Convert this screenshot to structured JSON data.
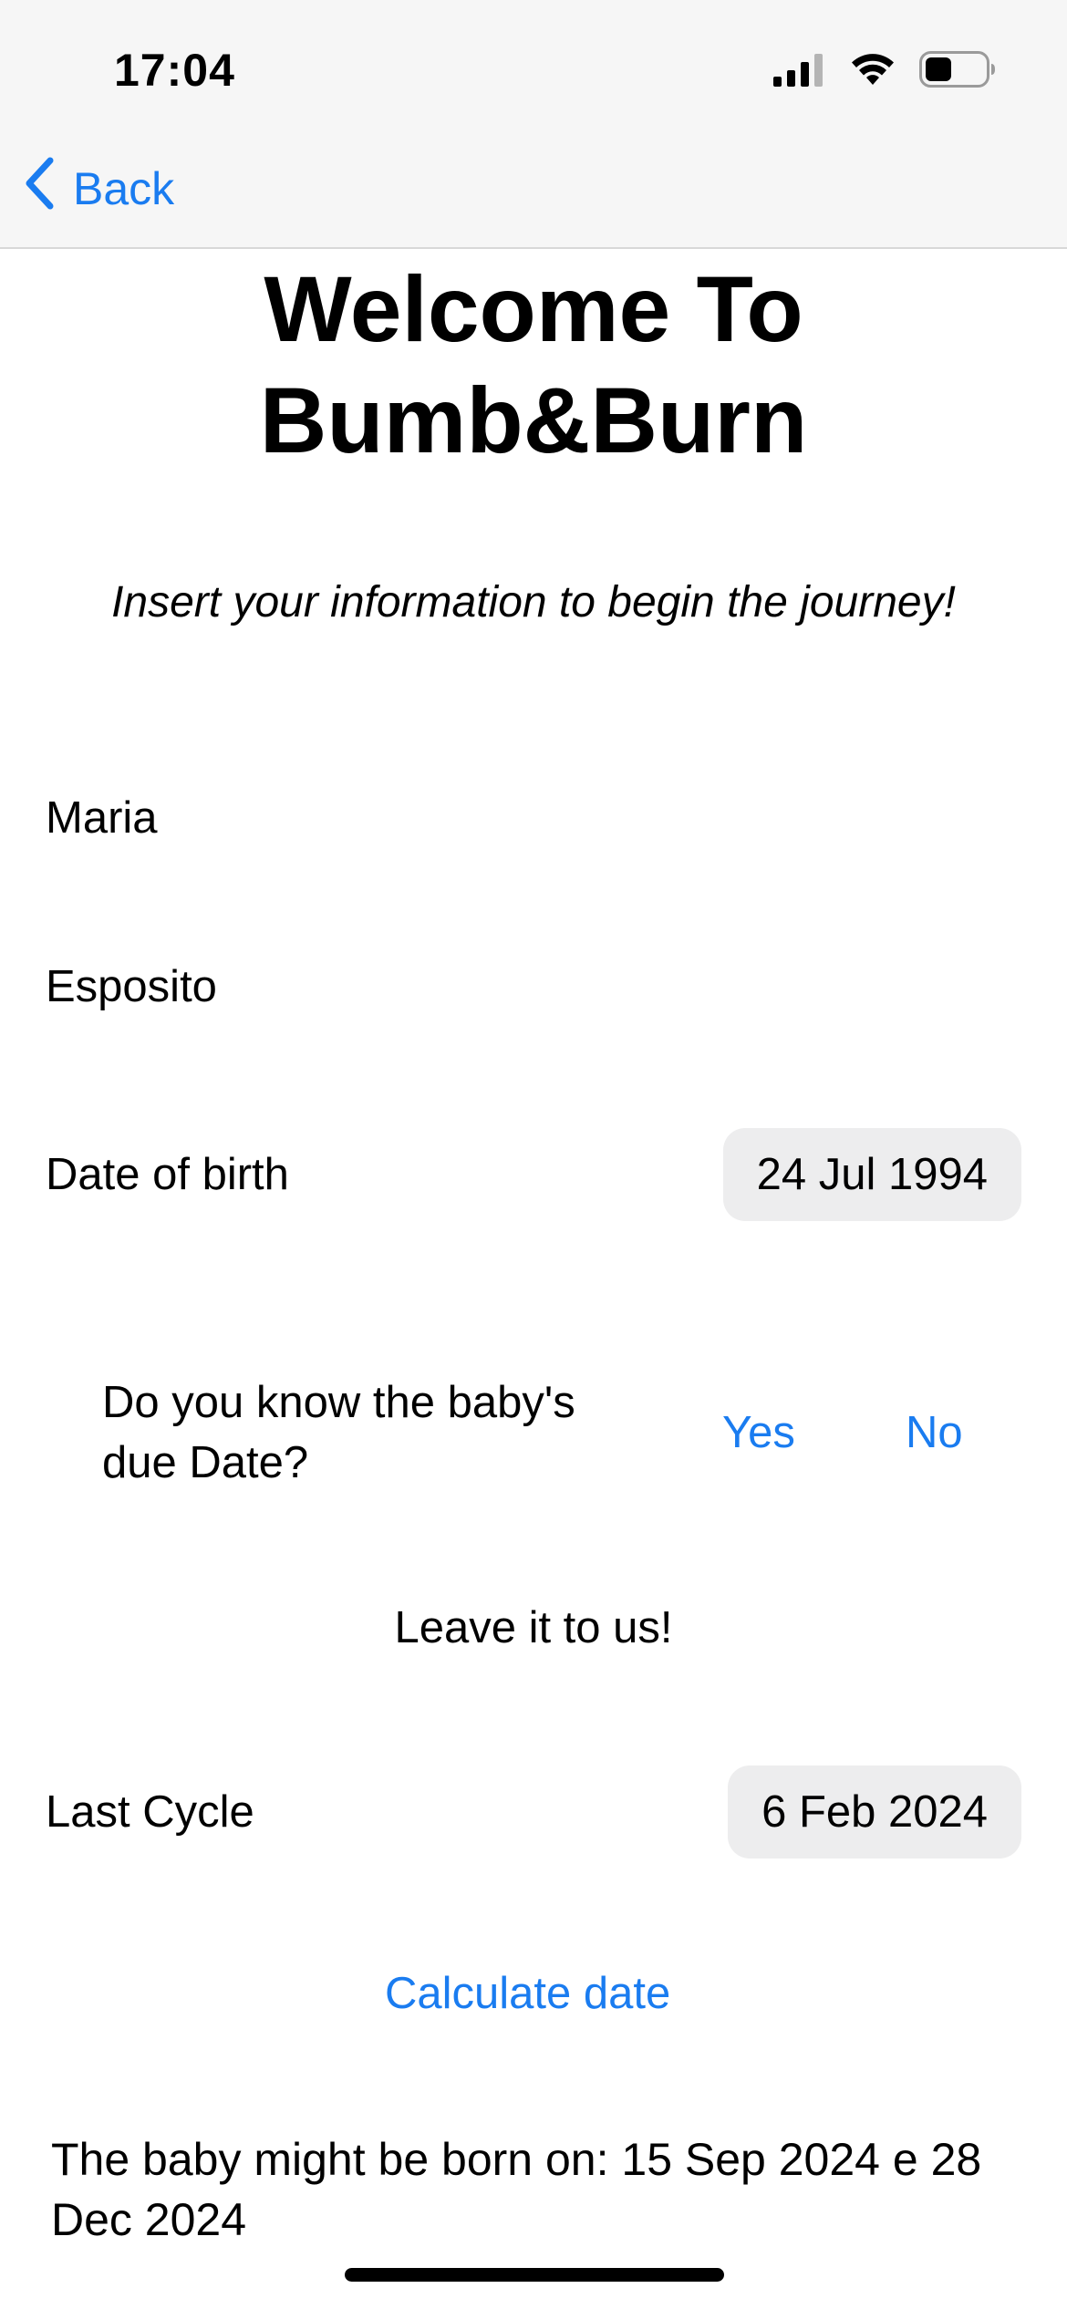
{
  "status_bar": {
    "time": "17:04",
    "icons": [
      "cellular-signal-icon",
      "wifi-icon",
      "battery-icon"
    ]
  },
  "nav": {
    "back_label": "Back"
  },
  "header": {
    "title_line1": "Welcome To",
    "title_line2": "Bumb&Burn",
    "subtitle": "Insert your information to begin the journey!"
  },
  "form": {
    "first_name": "Maria",
    "last_name": "Esposito",
    "date_of_birth_label": "Date of birth",
    "date_of_birth_value": "24 Jul 1994",
    "due_date_question": "Do you know the baby's due Date?",
    "yes_label": "Yes",
    "no_label": "No",
    "leave_it_text": "Leave it to us!",
    "last_cycle_label": "Last Cycle",
    "last_cycle_value": "6 Feb 2024",
    "calculate_label": "Calculate date",
    "result_text": "The baby might be born on: 15 Sep 2024 e 28 Dec 2024"
  },
  "colors": {
    "accent": "#1a7cf0",
    "nav_background": "#f6f6f6",
    "pill_background": "#ededee"
  }
}
